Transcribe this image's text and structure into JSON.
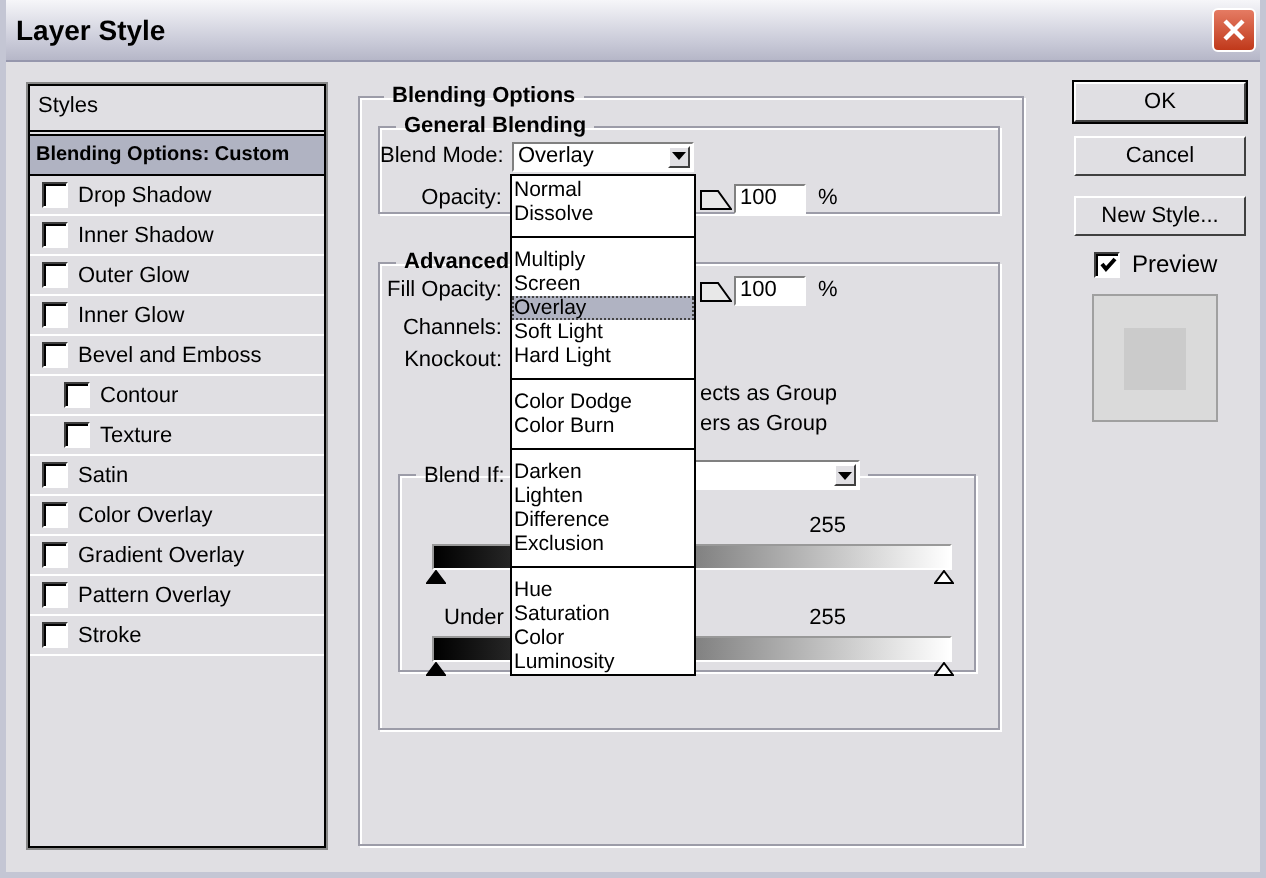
{
  "window": {
    "title": "Layer Style"
  },
  "styles_panel": {
    "header": "Styles",
    "items": [
      {
        "kind": "header",
        "label": "Blending Options: Custom",
        "selected": true
      },
      {
        "kind": "effect",
        "label": "Drop Shadow",
        "checked": false,
        "selected": false
      },
      {
        "kind": "effect",
        "label": "Inner Shadow",
        "checked": false,
        "selected": false
      },
      {
        "kind": "effect",
        "label": "Outer Glow",
        "checked": false,
        "selected": false
      },
      {
        "kind": "effect",
        "label": "Inner Glow",
        "checked": false,
        "selected": false
      },
      {
        "kind": "effect",
        "label": "Bevel and Emboss",
        "checked": false,
        "selected": false,
        "children": [
          {
            "kind": "effect",
            "label": "Contour",
            "checked": false,
            "selected": false
          },
          {
            "kind": "effect",
            "label": "Texture",
            "checked": false,
            "selected": false
          }
        ]
      },
      {
        "kind": "effect",
        "label": "Satin",
        "checked": false,
        "selected": false
      },
      {
        "kind": "effect",
        "label": "Color Overlay",
        "checked": false,
        "selected": false
      },
      {
        "kind": "effect",
        "label": "Gradient Overlay",
        "checked": false,
        "selected": false
      },
      {
        "kind": "effect",
        "label": "Pattern Overlay",
        "checked": false,
        "selected": false
      },
      {
        "kind": "effect",
        "label": "Stroke",
        "checked": false,
        "selected": false
      }
    ]
  },
  "blending_options": {
    "title": "Blending Options",
    "general": {
      "title": "General Blending",
      "blend_mode": {
        "label": "Blend Mode:",
        "value": "Overlay",
        "expanded": true
      },
      "opacity": {
        "label": "Opacity:",
        "value": "100",
        "unit": "%"
      }
    },
    "advanced": {
      "title": "Advanced",
      "fill_opacity": {
        "label": "Fill Opacity:",
        "value": "100",
        "unit": "%"
      },
      "channels_label": "Channels:",
      "knockout_label": "Knockout:",
      "options": [
        "ects as Group",
        "ers as Group"
      ],
      "blend_if": {
        "label": "Blend If:",
        "this_layer_value": "255",
        "underlying_label": "Under",
        "underlying_value": "255"
      }
    }
  },
  "blend_mode_menu": {
    "groups": [
      [
        {
          "label": "Normal",
          "selected": false
        },
        {
          "label": "Dissolve",
          "selected": false
        }
      ],
      [
        {
          "label": "Multiply",
          "selected": false
        },
        {
          "label": "Screen",
          "selected": false
        },
        {
          "label": "Overlay",
          "selected": true
        },
        {
          "label": "Soft Light",
          "selected": false
        },
        {
          "label": "Hard Light",
          "selected": false
        }
      ],
      [
        {
          "label": "Color Dodge",
          "selected": false
        },
        {
          "label": "Color Burn",
          "selected": false
        }
      ],
      [
        {
          "label": "Darken",
          "selected": false
        },
        {
          "label": "Lighten",
          "selected": false
        },
        {
          "label": "Difference",
          "selected": false
        },
        {
          "label": "Exclusion",
          "selected": false
        }
      ],
      [
        {
          "label": "Hue",
          "selected": false
        },
        {
          "label": "Saturation",
          "selected": false
        },
        {
          "label": "Color",
          "selected": false
        },
        {
          "label": "Luminosity",
          "selected": false
        }
      ]
    ]
  },
  "buttons": [
    {
      "label": "OK",
      "default": true
    },
    {
      "label": "Cancel",
      "default": false
    },
    {
      "label": "New Style...",
      "default": false
    }
  ],
  "preview": {
    "label": "Preview",
    "checked": true
  }
}
